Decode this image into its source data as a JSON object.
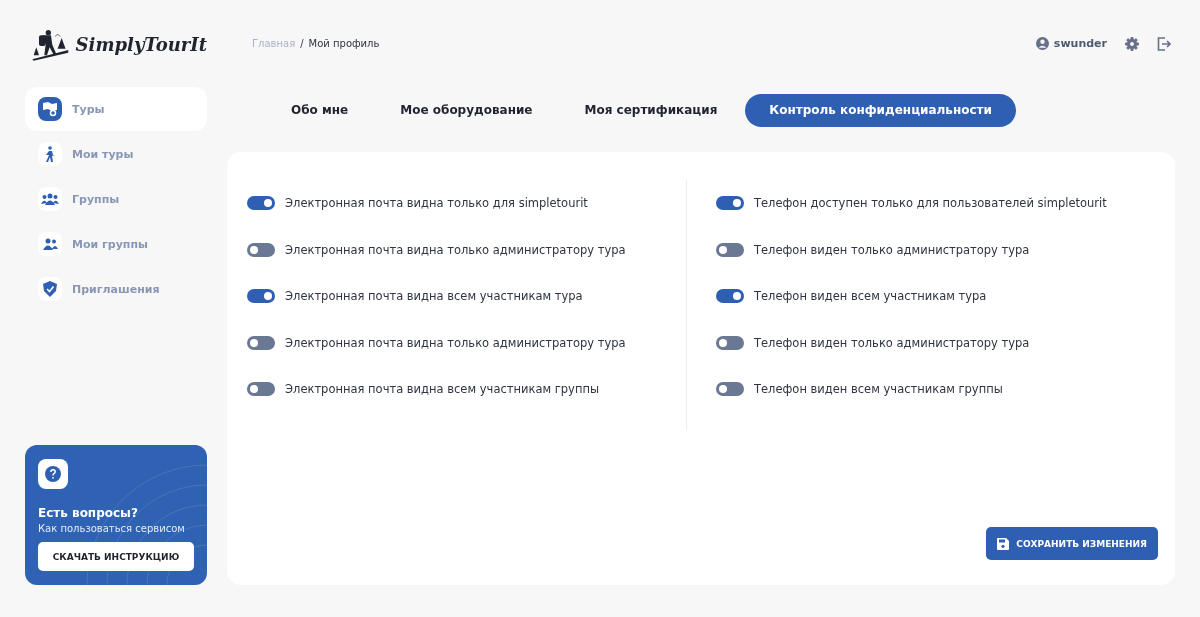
{
  "logo": {
    "text": "SimplyTourIt"
  },
  "breadcrumb": {
    "items": [
      "Главная",
      "Мой профиль"
    ],
    "separator": "/"
  },
  "user": {
    "name": "swunder"
  },
  "sidebar": {
    "items": [
      {
        "label": "Туры",
        "selected": true
      },
      {
        "label": "Мои туры",
        "selected": false
      },
      {
        "label": "Группы",
        "selected": false
      },
      {
        "label": "Мои группы",
        "selected": false
      },
      {
        "label": "Приглашения",
        "selected": false
      }
    ]
  },
  "help_card": {
    "title": "Есть вопросы?",
    "subtitle": "Как пользоваться сервисом",
    "button": "СКАЧАТЬ ИНСТРУКЦИЮ"
  },
  "tabs": [
    {
      "label": "Обо мне",
      "selected": false
    },
    {
      "label": "Мое оборудование",
      "selected": false
    },
    {
      "label": "Моя сертификация",
      "selected": false
    },
    {
      "label": "Контроль конфиденциальности",
      "selected": true
    }
  ],
  "privacy": {
    "email": [
      {
        "label": "Электронная почта видна только для simpletourit",
        "on": true
      },
      {
        "label": "Электронная почта видна только администратору тура",
        "on": false
      },
      {
        "label": "Электронная почта видна всем участникам тура",
        "on": true
      },
      {
        "label": "Электронная почта видна только администратору тура",
        "on": false
      },
      {
        "label": "Электронная почта видна всем участникам группы",
        "on": false
      }
    ],
    "phone": [
      {
        "label": "Телефон доступен только для пользователей simpletourit",
        "on": true
      },
      {
        "label": "Телефон виден только администратору тура",
        "on": false
      },
      {
        "label": "Телефон виден всем участникам тура",
        "on": true
      },
      {
        "label": "Телефон виден только администратору тура",
        "on": false
      },
      {
        "label": "Телефон виден всем участникам группы",
        "on": false
      }
    ]
  },
  "save_button": "СОХРАНИТЬ ИЗМЕНЕНИЯ"
}
